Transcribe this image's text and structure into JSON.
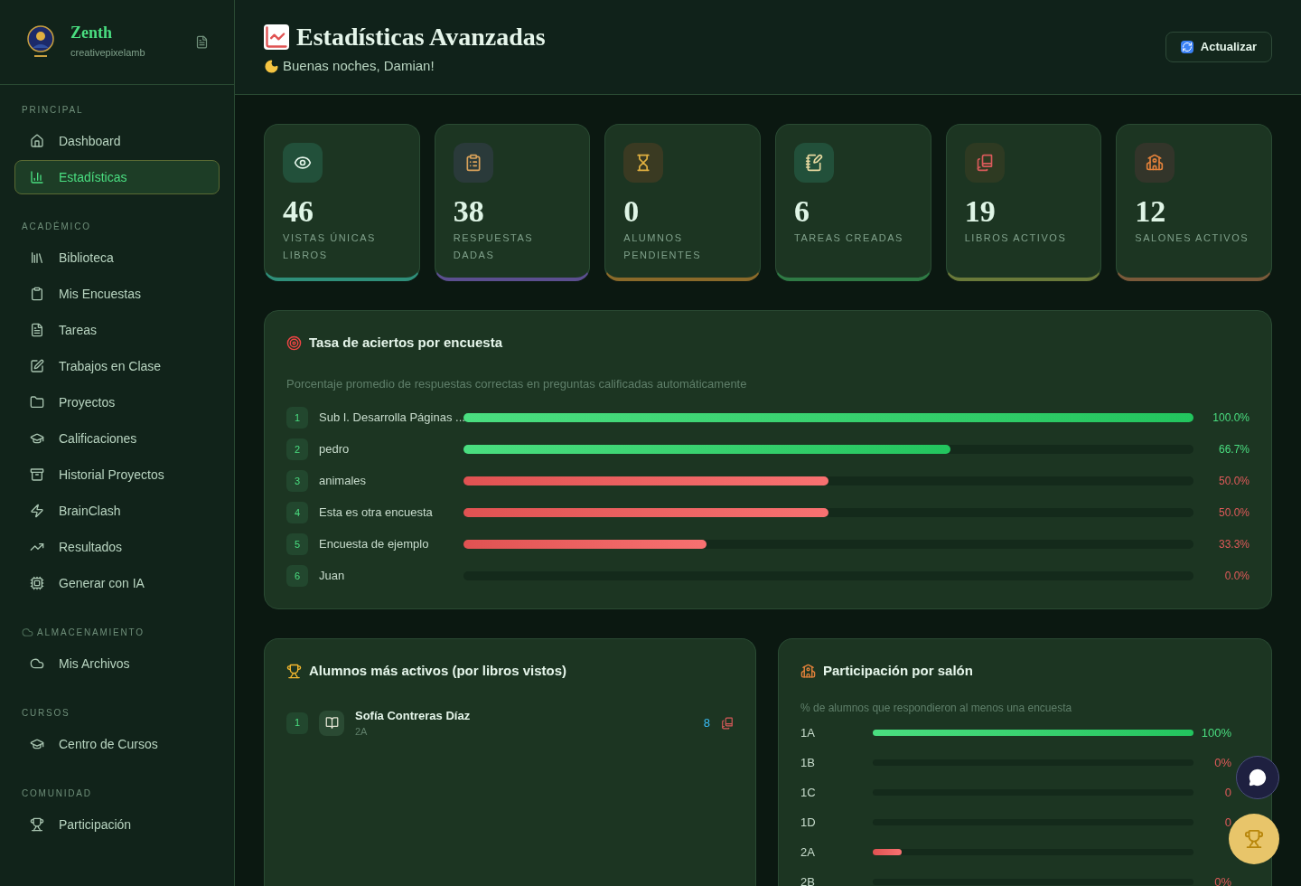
{
  "sidebar": {
    "brand": "Zenth",
    "user": "creativepixelamb",
    "sections": [
      {
        "title": "PRINCIPAL",
        "items": [
          {
            "label": "Dashboard",
            "selected": false
          },
          {
            "label": "Estadísticas",
            "selected": true
          }
        ]
      },
      {
        "title": "ACADÉMICO",
        "items": [
          {
            "label": "Biblioteca",
            "selected": false
          },
          {
            "label": "Mis Encuestas",
            "selected": false
          },
          {
            "label": "Tareas",
            "selected": false
          },
          {
            "label": "Trabajos en Clase",
            "selected": false
          },
          {
            "label": "Proyectos",
            "selected": false
          },
          {
            "label": "Calificaciones",
            "selected": false
          },
          {
            "label": "Historial Proyectos",
            "selected": false
          },
          {
            "label": "BrainClash",
            "selected": false
          },
          {
            "label": "Resultados",
            "selected": false
          },
          {
            "label": "Generar con IA",
            "selected": false
          }
        ]
      },
      {
        "title": "ALMACENAMIENTO",
        "items": [
          {
            "label": "Mis Archivos",
            "selected": false
          }
        ]
      },
      {
        "title": "CURSOS",
        "items": [
          {
            "label": "Centro de Cursos",
            "selected": false
          }
        ]
      },
      {
        "title": "COMUNIDAD",
        "items": [
          {
            "label": "Participación",
            "selected": false
          }
        ]
      }
    ]
  },
  "header": {
    "title": "Estadísticas Avanzadas",
    "greeting": "Buenas noches, Damian!",
    "refresh_button": "Actualizar"
  },
  "stats": [
    {
      "value": "46",
      "label": "VISTAS ÚNICAS LIBROS",
      "color": "#2f8f7a"
    },
    {
      "value": "38",
      "label": "RESPUESTAS DADAS",
      "color": "#5b4f8f"
    },
    {
      "value": "0",
      "label": "ALUMNOS PENDIENTES",
      "color": "#8a6a2a"
    },
    {
      "value": "6",
      "label": "TAREAS CREADAS",
      "color": "#2f7a45"
    },
    {
      "value": "19",
      "label": "LIBROS ACTIVOS",
      "color": "#6a7a3a"
    },
    {
      "value": "12",
      "label": "SALONES ACTIVOS",
      "color": "#7a5a3a"
    }
  ],
  "accuracy": {
    "title": "Tasa de aciertos por encuesta",
    "subtitle": "Porcentaje promedio de respuestas correctas en preguntas calificadas automáticamente",
    "rows": [
      {
        "rank": "1",
        "name": "Sub I. Desarrolla Páginas ...",
        "level": 1.0,
        "reading": "100.0%"
      },
      {
        "rank": "2",
        "name": "pedro",
        "level": 0.667,
        "reading": "66.7%"
      },
      {
        "rank": "3",
        "name": "animales",
        "level": 0.5,
        "reading": "50.0%"
      },
      {
        "rank": "4",
        "name": "Esta es otra encuesta",
        "level": 0.5,
        "reading": "50.0%"
      },
      {
        "rank": "5",
        "name": "Encuesta de ejemplo",
        "level": 0.333,
        "reading": "33.3%"
      },
      {
        "rank": "6",
        "name": "Juan",
        "reading": "0.0%"
      }
    ]
  },
  "active_students": {
    "title": "Alumnos más activos (por libros vistos)",
    "rows": [
      {
        "rank": "1",
        "name": "Sofía Contreras Díaz",
        "group": "2A",
        "count": "8"
      }
    ]
  },
  "participation": {
    "title": "Participación por salón",
    "subtitle": "% de alumnos que respondieron al menos una encuesta",
    "rows": [
      {
        "name": "1A",
        "level": 1.0,
        "reading": "100%"
      },
      {
        "name": "1B",
        "reading": "0%"
      },
      {
        "name": "1C",
        "reading": "0"
      },
      {
        "name": "1D",
        "reading": "0"
      },
      {
        "name": "2A",
        "level": 0.09
      },
      {
        "name": "2B",
        "reading": "0%"
      }
    ]
  }
}
